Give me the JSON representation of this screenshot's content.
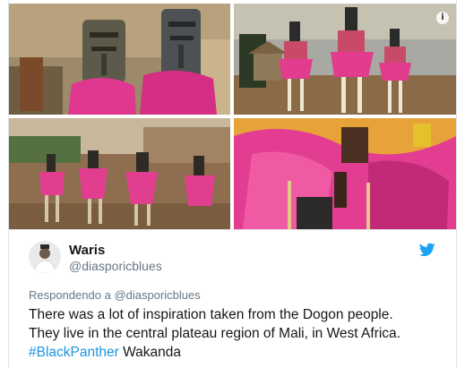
{
  "media": {
    "info_glyph": "i",
    "photos": [
      {
        "name": "masks-closeup"
      },
      {
        "name": "dancers-on-stilts"
      },
      {
        "name": "dancers-in-village"
      },
      {
        "name": "dancer-raffia-costume"
      }
    ]
  },
  "tweet": {
    "author_name": "Waris",
    "author_handle": "@diasporicblues",
    "replying_prefix": "Respondendo a",
    "replying_handle": "@diasporicblues",
    "text_line1": "There was a lot of inspiration taken from the Dogon people.",
    "text_line2": "They live in the central plateau region of Mali, in West Africa.",
    "hashtag": "#BlackPanther",
    "text_tail": " Wakanda"
  },
  "icons": {
    "platform": "twitter-bird-icon",
    "info": "info-icon"
  },
  "colors": {
    "link": "#1b95e0",
    "text": "#14171a",
    "muted": "#657786",
    "raffia_pink": "#e33a93"
  }
}
